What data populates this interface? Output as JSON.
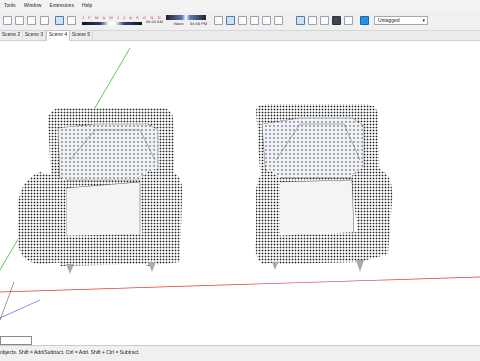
{
  "menu": [
    "Tools",
    "Window",
    "Extensions",
    "Help"
  ],
  "shadow": {
    "months": "J F M A M J J A S O N D",
    "time_start": "06:43 AM",
    "noon_label": "Noon",
    "time_end": "04:45 PM"
  },
  "tag_select": {
    "value": "Untagged"
  },
  "scenes": [
    "Scene 2",
    "Scene 3",
    "Scene 4",
    "Scene 5"
  ],
  "active_scene": "Scene 4",
  "status": {
    "text": "objects. Shift = Add/Subtract. Ctrl = Add. Shift + Ctrl = Subtract."
  },
  "colors": {
    "x_axis": "#e03c3c",
    "y_axis": "#3cb43c",
    "z_axis": "#3c5ae0",
    "selection": "#2b8fe3"
  },
  "icons": [
    "undo-icon",
    "redo-icon",
    "print-icon",
    "camera-icon",
    "compass-icon",
    "zoom-icon",
    "iso-view-icon",
    "top-view-icon",
    "front-view-icon",
    "right-view-icon",
    "back-view-icon",
    "left-view-icon",
    "xray-icon",
    "wireframe-icon",
    "hidden-line-icon",
    "shaded-icon",
    "shaded-texture-icon",
    "monochrome-icon"
  ]
}
